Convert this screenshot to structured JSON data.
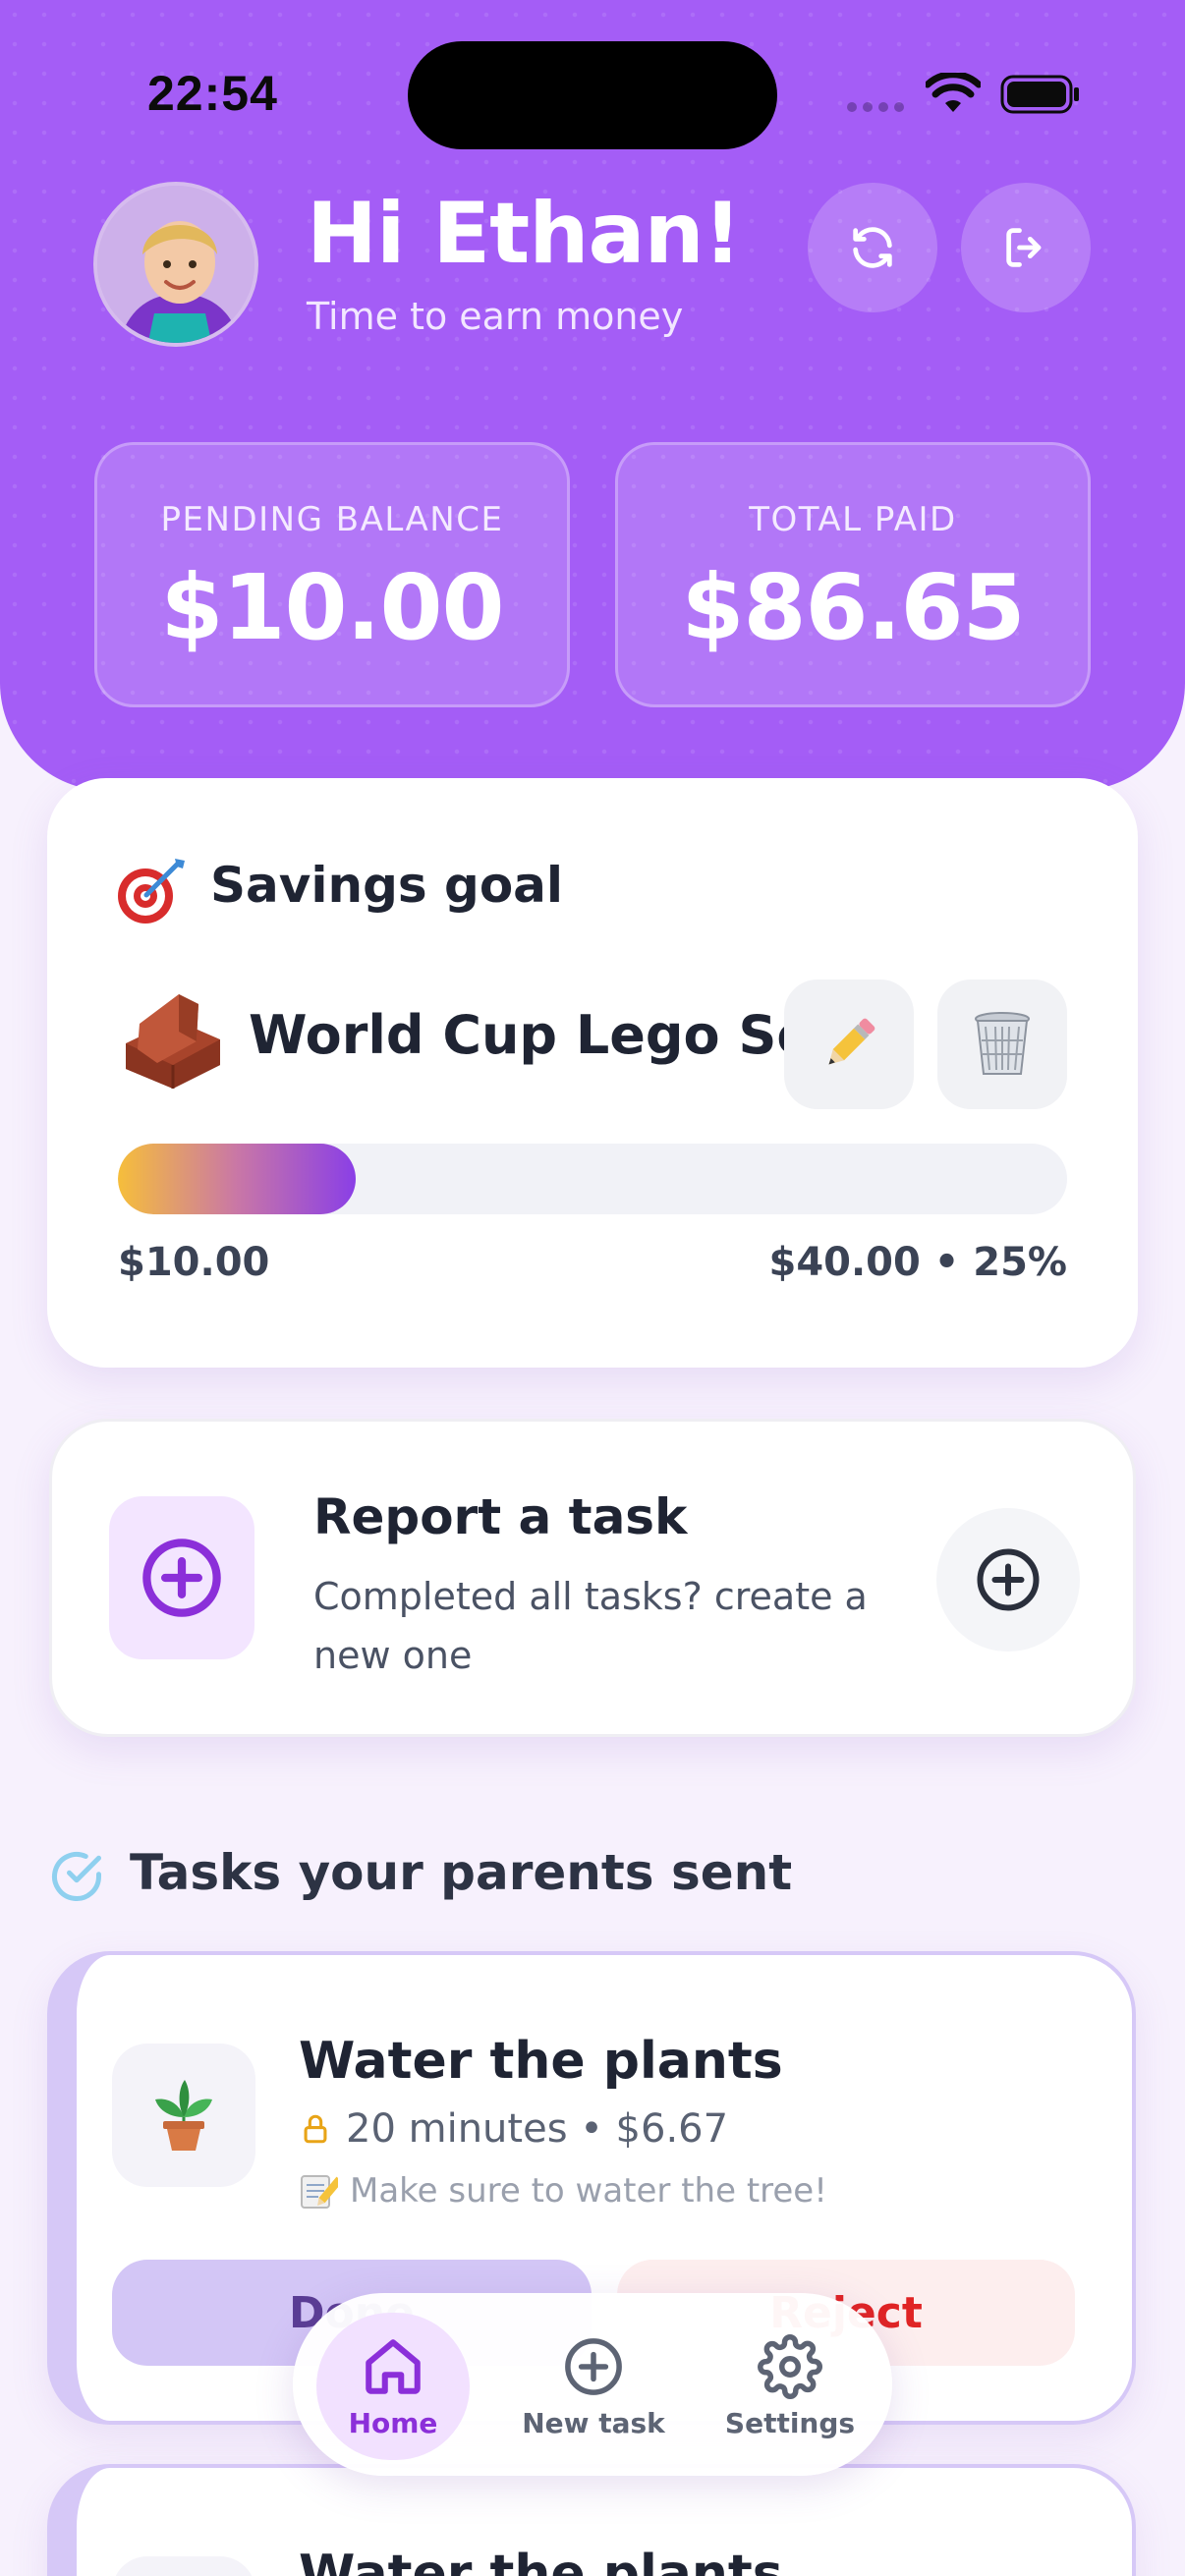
{
  "status_bar": {
    "time": "22:54"
  },
  "header": {
    "greeting": "Hi Ethan!",
    "subtitle": "Time to earn money",
    "refresh_icon": "refresh-icon",
    "logout_icon": "logout-icon"
  },
  "stats": {
    "pending_label": "PENDING BALANCE",
    "pending_value": "$10.00",
    "paid_label": "TOTAL PAID",
    "paid_value": "$86.65"
  },
  "goal": {
    "section_title": "Savings goal",
    "name": "World Cup Lego Set",
    "saved": "$10.00",
    "target": "$40.00 • 25%",
    "progress_percent": 25,
    "edit_icon": "pencil-icon",
    "delete_icon": "trash-icon"
  },
  "report": {
    "title": "Report a task",
    "subtitle": "Completed all tasks? create a new one"
  },
  "tasks_section": {
    "title": "Tasks your parents sent",
    "tasks": [
      {
        "title": "Water the plants",
        "meta": "20 minutes • $6.67",
        "note": "Make sure to water the tree!",
        "done_label": "Done",
        "reject_label": "Reject"
      },
      {
        "title": "Water the plants"
      }
    ]
  },
  "nav": {
    "items": [
      {
        "label": "Home",
        "icon": "home-icon",
        "active": true
      },
      {
        "label": "New task",
        "icon": "plus-circle-icon",
        "active": false
      },
      {
        "label": "Settings",
        "icon": "gear-icon",
        "active": false
      }
    ]
  },
  "colors": {
    "header_purple": "#a45df6",
    "accent_purple": "#8b2fd9",
    "reject_red": "#e02424",
    "progress_start": "#f6be3b",
    "progress_end": "#8a3fe6"
  }
}
